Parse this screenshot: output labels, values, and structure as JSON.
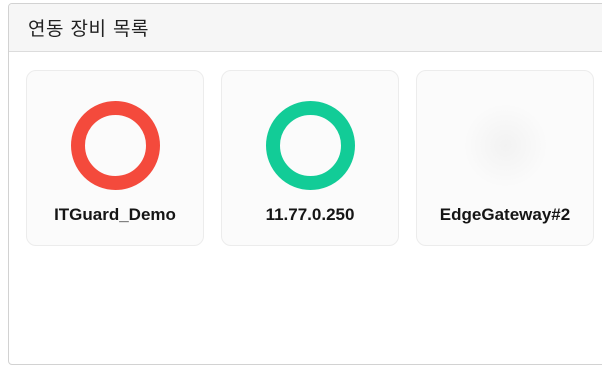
{
  "panel": {
    "title": "연동 장비 목록"
  },
  "devices": [
    {
      "name": "ITGuard_Demo",
      "status_color": "#f44a3c",
      "status_icon": "status-ring-icon"
    },
    {
      "name": "11.77.0.250",
      "status_color": "#12cc97",
      "status_icon": "status-ring-icon"
    },
    {
      "name": "EdgeGateway#2",
      "status_color": "#f0f0f0",
      "status_icon": "status-ring-icon"
    }
  ]
}
